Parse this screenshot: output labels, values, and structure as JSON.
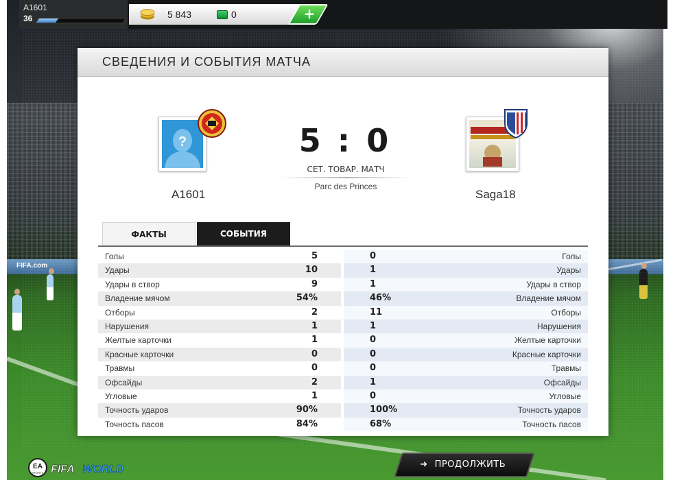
{
  "topbar": {
    "player_name": "A1601",
    "player_level": "36",
    "xp_progress": 0.22,
    "coins": "5 843",
    "points": "0",
    "add_label": "+"
  },
  "dialog": {
    "title": "СВЕДЕНИЯ И СОБЫТИЯ МАТЧА"
  },
  "match": {
    "home_team": "A1601",
    "away_team": "Saga18",
    "score": "5 : 0",
    "match_type": "СЕТ. ТОВАР. МАТЧ",
    "stadium": "Parc des Princes"
  },
  "tabs": {
    "facts": "ФАКТЫ",
    "events": "СОБЫТИЯ"
  },
  "stats": [
    {
      "label": "Голы",
      "home": "5",
      "away": "0"
    },
    {
      "label": "Удары",
      "home": "10",
      "away": "1"
    },
    {
      "label": "Удары в створ",
      "home": "9",
      "away": "1"
    },
    {
      "label": "Владение мячом",
      "home": "54%",
      "away": "46%"
    },
    {
      "label": "Отборы",
      "home": "2",
      "away": "11"
    },
    {
      "label": "Нарушения",
      "home": "1",
      "away": "1"
    },
    {
      "label": "Желтые карточки",
      "home": "1",
      "away": "0"
    },
    {
      "label": "Красные карточки",
      "home": "0",
      "away": "0"
    },
    {
      "label": "Травмы",
      "home": "0",
      "away": "0"
    },
    {
      "label": "Офсайды",
      "home": "2",
      "away": "1"
    },
    {
      "label": "Угловые",
      "home": "1",
      "away": "0"
    },
    {
      "label": "Точность ударов",
      "home": "90%",
      "away": "100%"
    },
    {
      "label": "Точность пасов",
      "home": "84%",
      "away": "68%"
    }
  ],
  "footer": {
    "continue_label": "ПРОДОЛЖИТЬ",
    "brand_sports": "SPORTS",
    "brand_ea": "EA",
    "brand_fifa": "FIFA",
    "brand_world": "WORLD"
  },
  "colors": {
    "avatar_blue": "#2f96d8",
    "continue_bg": "#151515",
    "points_green": "#1fae45"
  },
  "icons": {
    "coin": "coin-stack-icon",
    "points": "fifa-points-icon",
    "continue": "arrow-right-icon"
  }
}
